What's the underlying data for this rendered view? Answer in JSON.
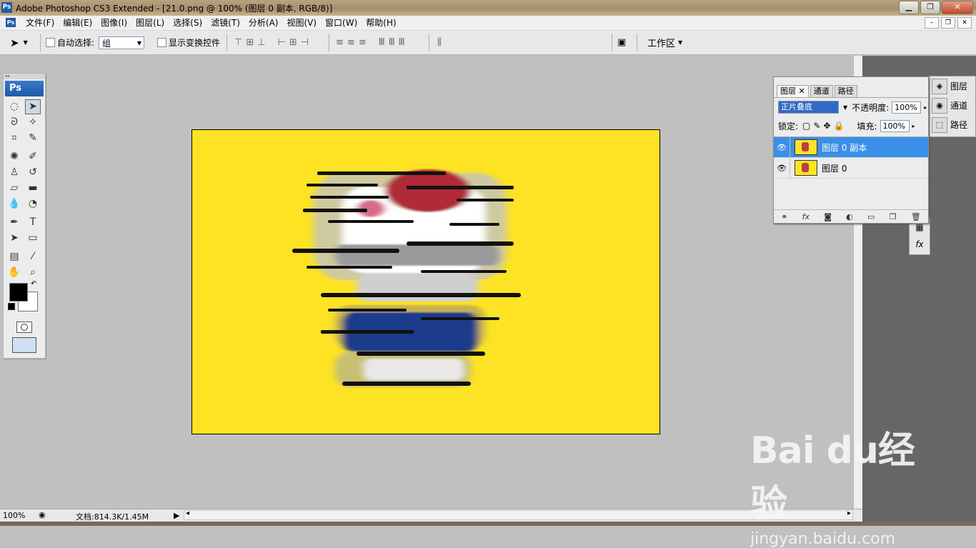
{
  "window": {
    "title": "Adobe Photoshop CS3 Extended - [21.0.png @ 100% (图层 0 副本, RGB/8)]",
    "logo_text": "Ps",
    "controls": [
      "▁",
      "❐",
      "✕"
    ]
  },
  "menubar": {
    "items": [
      "文件(F)",
      "编辑(E)",
      "图像(I)",
      "图层(L)",
      "选择(S)",
      "滤镜(T)",
      "分析(A)",
      "视图(V)",
      "窗口(W)",
      "帮助(H)"
    ],
    "doc_controls": [
      "–",
      "❐",
      "✕"
    ]
  },
  "options": {
    "auto_select_label": "自动选择:",
    "auto_select_value": "组",
    "show_transform_label": "显示变换控件",
    "workspace_label": "工作区"
  },
  "tools": {
    "ps_badge": "Ps"
  },
  "layers_panel": {
    "tabs": [
      "图层",
      "通道",
      "路径"
    ],
    "blend_mode": "正片叠底",
    "opacity_label": "不透明度:",
    "opacity_value": "100%",
    "lock_label": "锁定:",
    "fill_label": "填充:",
    "fill_value": "100%",
    "layers": [
      {
        "name": "图层 0 副本",
        "selected": true
      },
      {
        "name": "图层 0",
        "selected": false
      }
    ]
  },
  "dock": {
    "items": [
      "图层",
      "通道",
      "路径"
    ]
  },
  "status": {
    "zoom": "100%",
    "doc_info": "文档:814.3K/1.45M"
  },
  "watermark": {
    "brand": "Bai du经验",
    "url": "jingyan.baidu.com"
  },
  "colors": {
    "canvas_bg": "#fde324",
    "selection": "#3a8fe8",
    "ps_blue": "#1f5aa8"
  }
}
